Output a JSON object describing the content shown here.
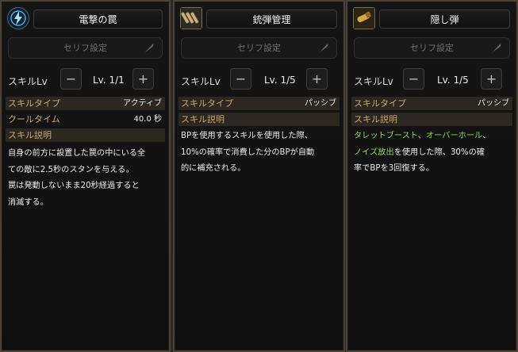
{
  "panels": [
    {
      "title": "電撃の罠",
      "icon": "lightning-trap-icon",
      "serif_label": "セリフ設定",
      "lv_label": "スキルLv",
      "lv_value": "Lv. 1/1",
      "minus": "−",
      "plus": "+",
      "type_label": "スキルタイプ",
      "type_value": "アクティブ",
      "cooldown_label": "クールタイム",
      "cooldown_value": "40.0 秒",
      "desc_label": "スキル説明",
      "desc_line1": "自身の前方に設置した罠の中にいる全",
      "desc_line2": "ての敵に2.5秒のスタンを与える。",
      "desc_line3": "罠は発動しないまま20秒経過すると",
      "desc_line4": "消滅する。"
    },
    {
      "title": "銃弾管理",
      "icon": "ammo-belt-icon",
      "serif_label": "セリフ設定",
      "lv_label": "スキルLv",
      "lv_value": "Lv. 1/5",
      "minus": "−",
      "plus": "+",
      "type_label": "スキルタイプ",
      "type_value": "パッシブ",
      "desc_label": "スキル説明",
      "desc_line1": "BPを使用するスキルを使用した際、",
      "desc_line2": "10%の確率で消費した分のBPが自動",
      "desc_line3": "的に補充される。"
    },
    {
      "title": "隠し弾",
      "icon": "hidden-bullet-icon",
      "serif_label": "セリフ設定",
      "lv_label": "スキルLv",
      "lv_value": "Lv. 1/5",
      "minus": "−",
      "plus": "+",
      "type_label": "スキルタイプ",
      "type_value": "パッシブ",
      "desc_label": "スキル説明",
      "desc_skill1": "タレットブースト",
      "desc_sep1": "、",
      "desc_skill2": "オーバーホール",
      "desc_sep2": "、",
      "desc_skill3": "ノイズ放出",
      "desc_rest1": "を使用した際、30%の確",
      "desc_line3": "率でBPを3回復する。"
    }
  ],
  "colors": {
    "gold_label": "#c9a76b",
    "skill_green": "#8ed34d",
    "panel_border": "#4a4236"
  }
}
